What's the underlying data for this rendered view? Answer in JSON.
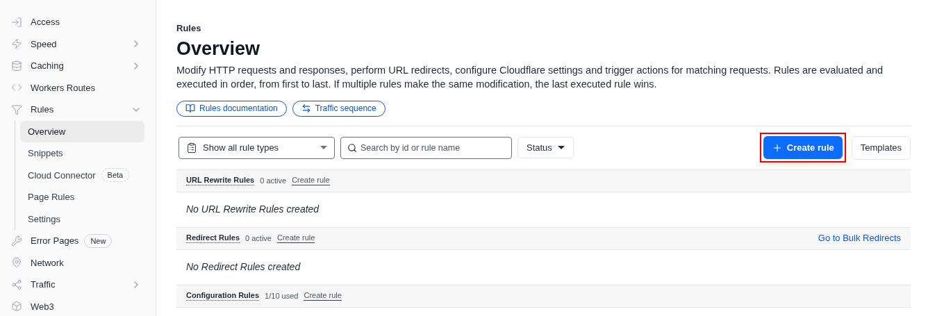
{
  "sidebar": {
    "items": [
      {
        "label": "Access",
        "expandable": false
      },
      {
        "label": "Speed",
        "expandable": true
      },
      {
        "label": "Caching",
        "expandable": true
      },
      {
        "label": "Workers Routes",
        "expandable": false
      },
      {
        "label": "Rules",
        "expandable": true,
        "expanded": true,
        "children": [
          {
            "label": "Overview",
            "selected": true
          },
          {
            "label": "Snippets",
            "selected": false
          },
          {
            "label": "Cloud Connector",
            "selected": false,
            "badge": "Beta"
          },
          {
            "label": "Page Rules",
            "selected": false
          },
          {
            "label": "Settings",
            "selected": false
          }
        ]
      },
      {
        "label": "Error Pages",
        "expandable": false,
        "badge": "New"
      },
      {
        "label": "Network",
        "expandable": false
      },
      {
        "label": "Traffic",
        "expandable": true
      },
      {
        "label": "Web3",
        "expandable": false
      }
    ]
  },
  "header": {
    "eyebrow": "Rules",
    "title": "Overview",
    "description": "Modify HTTP requests and responses, perform URL redirects, configure Cloudflare settings and trigger actions for matching requests. Rules are evaluated and executed in order, from first to last. If multiple rules make the same modification, the last executed rule wins.",
    "links": [
      "Rules documentation",
      "Traffic sequence"
    ]
  },
  "toolbar": {
    "rule_type": "Show all rule types",
    "search": {
      "placeholder": "Search by id or rule name"
    },
    "status": "Status",
    "create": {
      "label": "Create rule",
      "highlighted": true
    },
    "templates": "Templates"
  },
  "sections": [
    {
      "title": "URL Rewrite Rules",
      "count": "0 active",
      "action": "Create rule",
      "empty": "No URL Rewrite Rules created"
    },
    {
      "title": "Redirect Rules",
      "count": "0 active",
      "action": "Create rule",
      "link": "Go to Bulk Redirects",
      "empty": "No Redirect Rules created"
    },
    {
      "title": "Configuration Rules",
      "count": "1/10 used",
      "action": "Create rule"
    }
  ]
}
